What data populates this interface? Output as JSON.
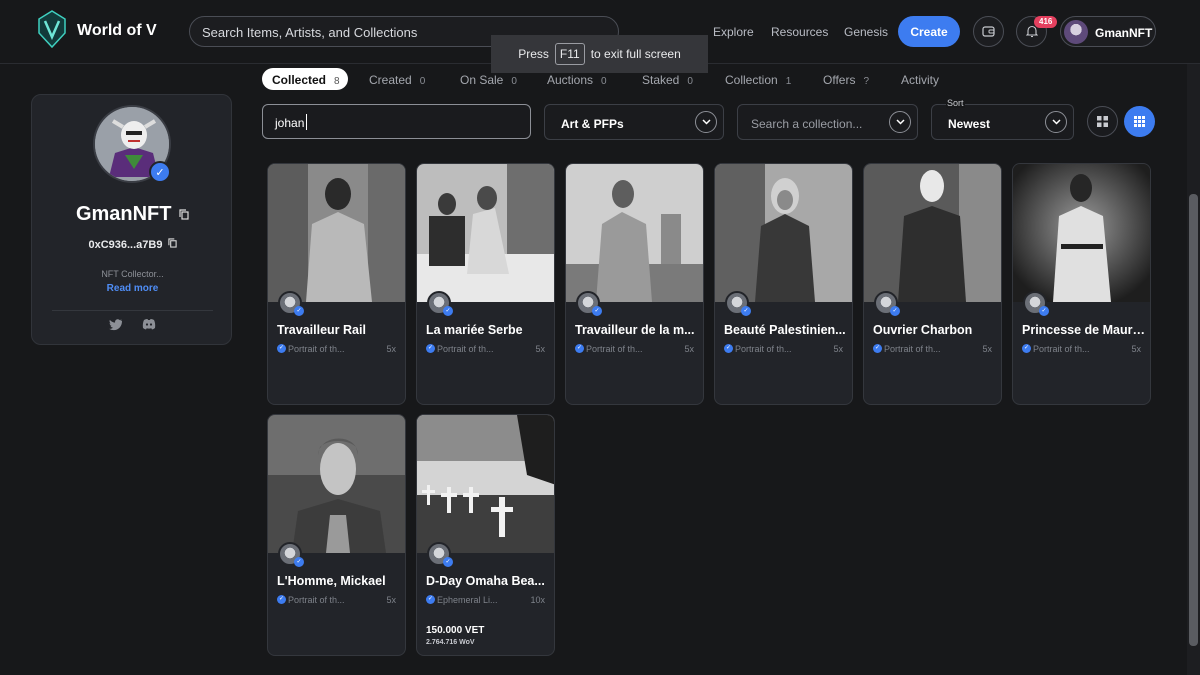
{
  "header": {
    "brand": "World of V",
    "search_placeholder": "Search Items, Artists, and Collections",
    "nav": [
      "Explore",
      "Resources",
      "Genesis"
    ],
    "create_label": "Create",
    "notification_count": "416",
    "username": "GmanNFT"
  },
  "toast": {
    "press": "Press",
    "key": "F11",
    "rest": "to exit full screen"
  },
  "tabs": [
    {
      "label": "Collected",
      "count": "8"
    },
    {
      "label": "Created",
      "count": "0"
    },
    {
      "label": "On Sale",
      "count": "0"
    },
    {
      "label": "Auctions",
      "count": "0"
    },
    {
      "label": "Staked",
      "count": "0"
    },
    {
      "label": "Collection",
      "count": "1"
    },
    {
      "label": "Offers",
      "count": "?"
    },
    {
      "label": "Activity",
      "count": ""
    }
  ],
  "profile": {
    "name": "GmanNFT",
    "address": "0xC936...a7B9",
    "bio": "NFT Collector...",
    "read_more": "Read more"
  },
  "filters": {
    "search_value": "johan",
    "category": "Art & PFPs",
    "collection_placeholder": "Search a collection...",
    "sort_label": "Sort",
    "sort_value": "Newest"
  },
  "colors": {
    "accent": "#3d7cf0",
    "badge": "#e4405f",
    "bg": "#17181a",
    "card": "#222429"
  },
  "cards": [
    {
      "title": "Travailleur Rail",
      "collection": "Portrait of th...",
      "qty": "5x",
      "price": "",
      "price_wov": ""
    },
    {
      "title": "La mariée Serbe",
      "collection": "Portrait of th...",
      "qty": "5x",
      "price": "",
      "price_wov": ""
    },
    {
      "title": "Travailleur de la m...",
      "collection": "Portrait of th...",
      "qty": "5x",
      "price": "",
      "price_wov": ""
    },
    {
      "title": "Beauté Palestinien...",
      "collection": "Portrait of th...",
      "qty": "5x",
      "price": "",
      "price_wov": ""
    },
    {
      "title": "Ouvrier Charbon",
      "collection": "Portrait of th...",
      "qty": "5x",
      "price": "",
      "price_wov": ""
    },
    {
      "title": "Princesse de Mauri...",
      "collection": "Portrait of th...",
      "qty": "5x",
      "price": "",
      "price_wov": ""
    },
    {
      "title": "L'Homme, Mickael",
      "collection": "Portrait of th...",
      "qty": "5x",
      "price": "",
      "price_wov": ""
    },
    {
      "title": "D-Day Omaha Bea...",
      "collection": "Ephemeral Li...",
      "qty": "10x",
      "price": "150.000 VET",
      "price_wov": "2.764.716 WoV"
    }
  ]
}
